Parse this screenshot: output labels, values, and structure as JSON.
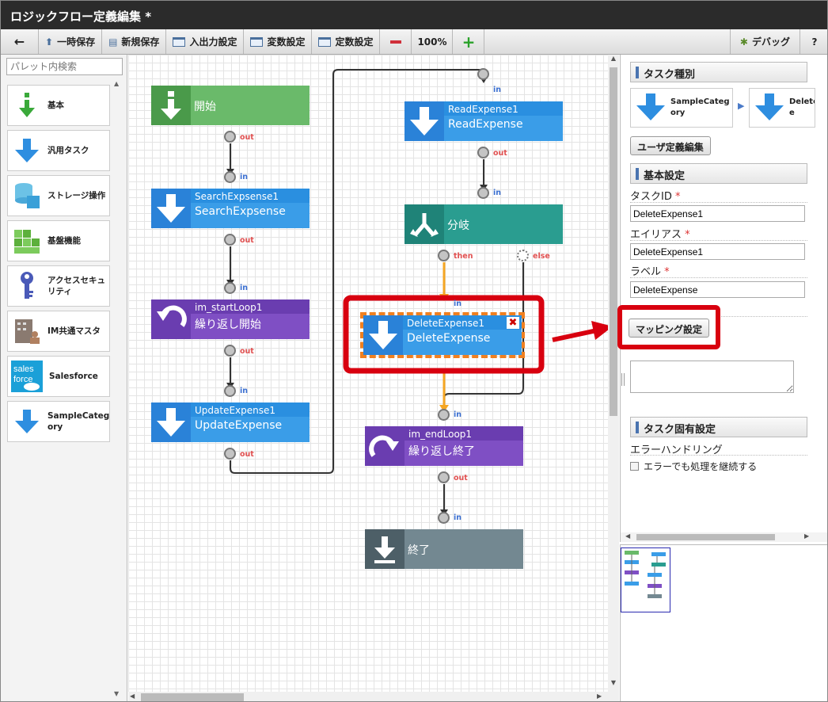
{
  "window": {
    "title": "ロジックフロー定義編集 *"
  },
  "toolbar": {
    "back": "←",
    "temp_save": "一時保存",
    "new_save": "新規保存",
    "io_settings": "入出力設定",
    "var_settings": "変数設定",
    "const_settings": "定数設定",
    "zoom_out": "−",
    "zoom": "100%",
    "zoom_in": "+",
    "debug": "デバッグ",
    "help": "?"
  },
  "palette": {
    "search_placeholder": "パレット内検索",
    "items": [
      {
        "label": "基本",
        "icon": "down-arrow-green-icon"
      },
      {
        "label": "汎用タスク",
        "icon": "down-arrow-blue-icon"
      },
      {
        "label": "ストレージ操作",
        "icon": "database-icon"
      },
      {
        "label": "基盤機能",
        "icon": "grid-blocks-icon"
      },
      {
        "label": "アクセスセキュ\nリティ",
        "icon": "key-icon"
      },
      {
        "label": "IM共通マスタ",
        "icon": "building-icon"
      },
      {
        "label": "Salesforce",
        "icon": "salesforce-logo"
      },
      {
        "label": "SampleCateg\nory",
        "icon": "down-arrow-blue-icon"
      }
    ]
  },
  "flow": {
    "start": {
      "label": "開始"
    },
    "search": {
      "id": "SearchExpsense1",
      "label": "SearchExpsense"
    },
    "loop_start": {
      "id": "im_startLoop1",
      "label": "繰り返し開始"
    },
    "update": {
      "id": "UpdateExpense1",
      "label": "UpdateExpense"
    },
    "read": {
      "id": "ReadExpense1",
      "label": "ReadExpense"
    },
    "branch": {
      "label": "分岐"
    },
    "delete": {
      "id": "DeleteExpense1",
      "label": "DeleteExpense"
    },
    "loop_end": {
      "id": "im_endLoop1",
      "label": "繰り返し終了"
    },
    "end": {
      "label": "終了"
    },
    "ports": {
      "in": "in",
      "out": "out",
      "then": "then",
      "else": "else"
    }
  },
  "task_type": {
    "title": "タスク種別",
    "category": "SampleCateg\nory",
    "task": "Delete\ne"
  },
  "user_def_button": "ユーザ定義編集",
  "basic": {
    "title": "基本設定",
    "task_id_label": "タスクID",
    "task_id": "DeleteExpense1",
    "alias_label": "エイリアス",
    "alias": "DeleteExpense1",
    "label_label": "ラベル",
    "label": "DeleteExpense",
    "mapping_button": "マッピング設定",
    "required": "*"
  },
  "specific": {
    "title": "タスク固有設定",
    "error_label": "エラーハンドリング",
    "continue_label": "エラーでも処理を継続する",
    "continue_checked": false
  },
  "colors": {
    "green": "#6aba6a",
    "blue": "#3a9de8",
    "purple": "#7f4fc4",
    "teal": "#2a9d90",
    "gray": "#738891",
    "highlight": "#d8000f"
  }
}
